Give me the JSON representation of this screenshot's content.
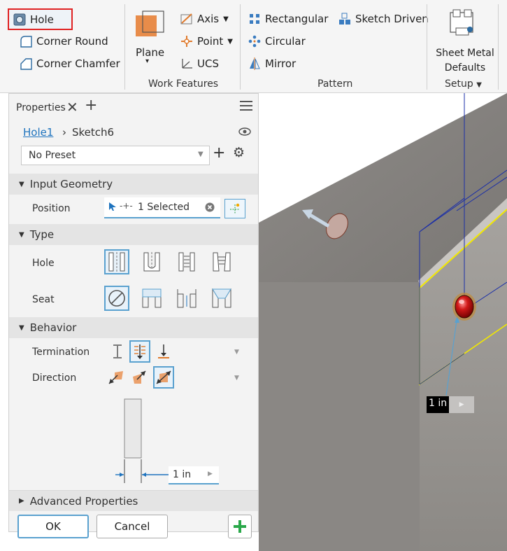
{
  "ribbon": {
    "hole": "Hole",
    "corner_round": "Corner Round",
    "corner_chamfer": "Corner Chamfer",
    "plane": "Plane",
    "axis": "Axis",
    "point": "Point",
    "ucs": "UCS",
    "work_features": "Work Features",
    "rectangular": "Rectangular",
    "sketch_driven": "Sketch Driven",
    "circular": "Circular",
    "mirror": "Mirror",
    "pattern": "Pattern",
    "sheet_metal_defaults_1": "Sheet Metal",
    "sheet_metal_defaults_2": "Defaults",
    "setup": "Setup"
  },
  "panel": {
    "tab": "Properties",
    "breadcrumb_hole": "Hole1",
    "breadcrumb_sketch": "Sketch6",
    "preset": "No Preset",
    "input_geometry": "Input Geometry",
    "position_label": "Position",
    "position_value": "1 Selected",
    "type_section": "Type",
    "hole_label": "Hole",
    "seat_label": "Seat",
    "behavior_section": "Behavior",
    "termination_label": "Termination",
    "direction_label": "Direction",
    "diameter_value": "1 in",
    "advanced": "Advanced Properties",
    "ok": "OK",
    "cancel": "Cancel"
  },
  "viewport": {
    "dimension_value": "1 in"
  },
  "colors": {
    "accent": "#1e73be",
    "selection": "#5aa1cf",
    "highlight_red": "#e02222",
    "model_gray": "#8a8784",
    "sketch_blue": "#1a2ea8",
    "edge_yellow": "#f2e800"
  }
}
